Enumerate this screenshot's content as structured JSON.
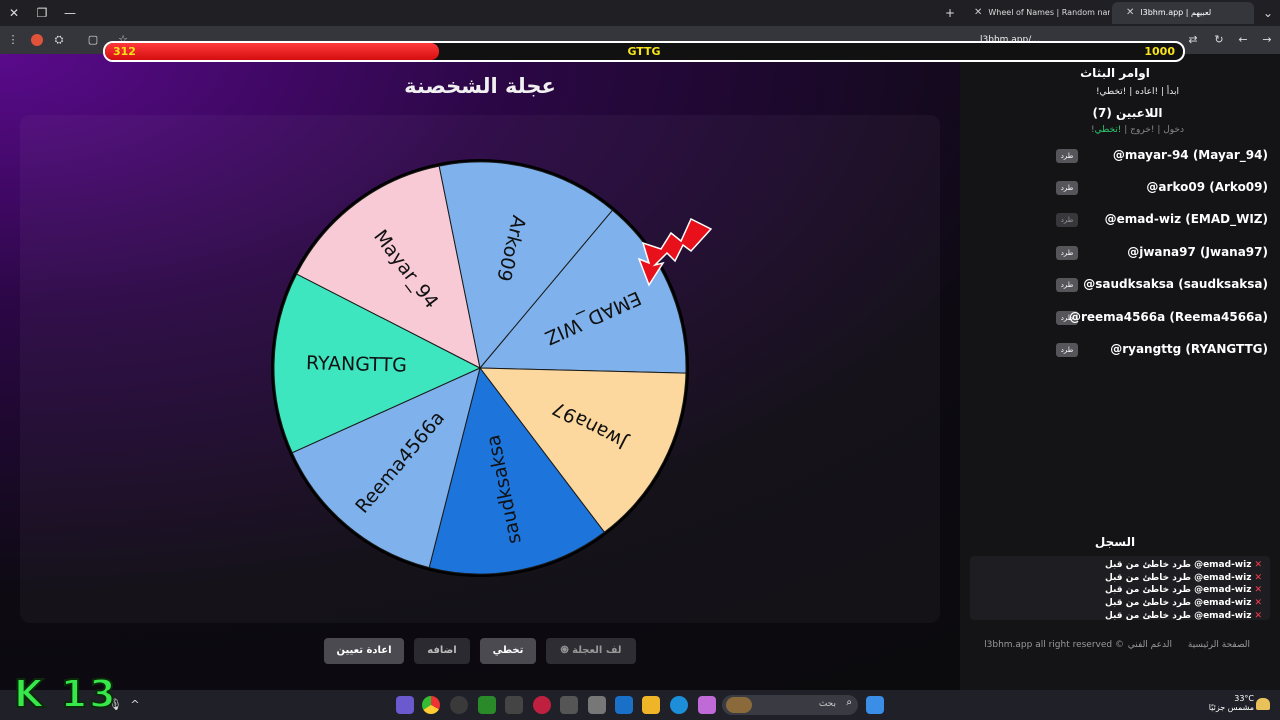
{
  "browser": {
    "tabs": [
      {
        "title": "Wheel of Names | Random nam",
        "active": false
      },
      {
        "title": "l3bhm.app | لعبيهم",
        "active": true
      }
    ],
    "url": "l3bhm.app/..."
  },
  "health_bar": {
    "current": "312",
    "name": "GTTG",
    "max": "1000",
    "fill_fraction": 0.31
  },
  "page": {
    "title": "عجلة الشخصنة",
    "buttons": {
      "spin": "لف العجلة",
      "skip": "تخطي",
      "add": "اضافه",
      "reset": "اعادة تعيين"
    }
  },
  "wheel": {
    "segments": [
      {
        "label": "EMAD_WIZ",
        "color": "#7fb2ec"
      },
      {
        "label": "Jwana97",
        "color": "#fcd89e"
      },
      {
        "label": "saudksaksa",
        "color": "#1d74db"
      },
      {
        "label": "Reema4566a",
        "color": "#7fb2ec"
      },
      {
        "label": "RYANGTTG",
        "color": "#3ee6c0"
      },
      {
        "label": "Mayar_94",
        "color": "#f7cad6"
      },
      {
        "label": "Arko09",
        "color": "#7fb2ec"
      }
    ]
  },
  "sidebar": {
    "commands_title": "اوامر البثاث",
    "commands_list": "!ابدأ | !اعاده | !تخطي",
    "players_title": "اللاعبين (7)",
    "player_commands": {
      "join": "!دخول",
      "leave": "!خروج",
      "skip": "!تخطي"
    },
    "kick_label": "طرد",
    "players": [
      "@mayar-94 (Mayar_94)",
      "@arko09 (Arko09)",
      "@emad-wiz (EMAD_WIZ)",
      "@jwana97 (Jwana97)",
      "@saudksaksa (saudksaksa)",
      "@reema4566a (Reema4566a)",
      "@ryangttg (RYANGTTG)"
    ],
    "log_title": "السجل",
    "log_entries": [
      "طرد خاطئ من قبل @emad-wiz",
      "طرد خاطئ من قبل @emad-wiz",
      "طرد خاطئ من قبل @emad-wiz",
      "طرد خاطئ من قبل @emad-wiz",
      "طرد خاطئ من قبل @emad-wiz"
    ],
    "footer": {
      "home": "الصفحة الرئيسية",
      "support": "الدعم الفني",
      "copyright": "l3bhm.app all right reserved ©"
    }
  },
  "taskbar": {
    "search_placeholder": "بحث",
    "temperature": "33°C",
    "weather_desc": "مشمس جزئيًا"
  },
  "overlay_logo": "K 13"
}
